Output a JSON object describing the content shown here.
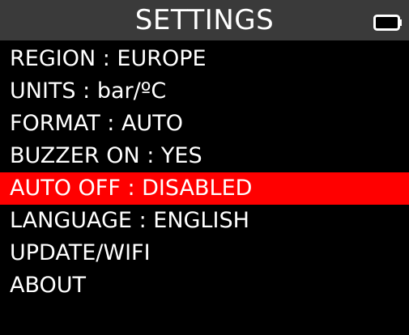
{
  "header": {
    "title": "SETTINGS",
    "battery_icon": "battery-icon"
  },
  "menu": {
    "items": [
      {
        "label": "REGION : EUROPE",
        "selected": false
      },
      {
        "label": "UNITS : bar/ºC",
        "selected": false
      },
      {
        "label": "FORMAT : AUTO",
        "selected": false
      },
      {
        "label": "BUZZER ON : YES",
        "selected": false
      },
      {
        "label": "AUTO OFF : DISABLED",
        "selected": true
      },
      {
        "label": "LANGUAGE : ENGLISH",
        "selected": false
      },
      {
        "label": "UPDATE/WIFI",
        "selected": false
      },
      {
        "label": "ABOUT",
        "selected": false
      }
    ]
  },
  "colors": {
    "background": "#000000",
    "title_bar": "#3a3a3a",
    "text": "#ffffff",
    "selection": "#ff0000"
  }
}
